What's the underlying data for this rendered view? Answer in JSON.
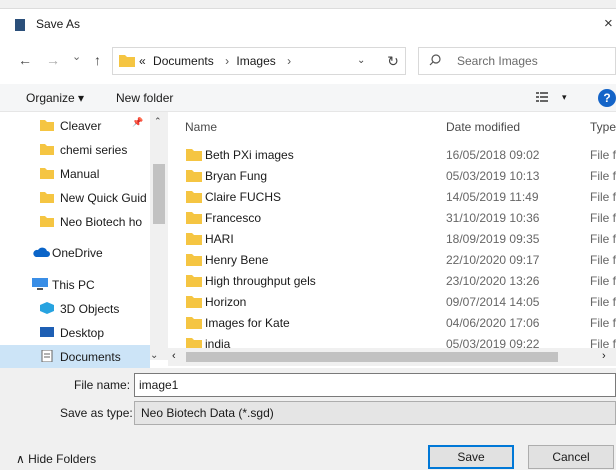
{
  "window": {
    "title": "Save As",
    "close_glyph": "×"
  },
  "nav_buttons": {
    "back": "←",
    "forward": "→",
    "recent": "⌄",
    "up": "↑"
  },
  "address": {
    "crumbs": [
      "«",
      "Documents",
      "›",
      "Images",
      "›"
    ],
    "dropdown": "⌄"
  },
  "refresh_glyph": "↻",
  "search": {
    "placeholder": "Search Images"
  },
  "toolbar": {
    "organize": "Organize ▾",
    "new_folder": "New folder",
    "view_dropdown": "▾",
    "help": "?"
  },
  "sidebar": {
    "items": [
      {
        "label": "Cleaver",
        "icon": "folder-icon"
      },
      {
        "label": "chemi series",
        "icon": "folder-icon"
      },
      {
        "label": "Manual",
        "icon": "folder-icon"
      },
      {
        "label": "New Quick Guid",
        "icon": "folder-icon"
      },
      {
        "label": "Neo Biotech ho",
        "icon": "folder-icon"
      },
      {
        "label": "OneDrive",
        "icon": "cloud-icon"
      },
      {
        "label": "This PC",
        "icon": "pc-icon"
      },
      {
        "label": "3D Objects",
        "icon": "cube-icon"
      },
      {
        "label": "Desktop",
        "icon": "desktop-icon"
      },
      {
        "label": "Documents",
        "icon": "documents-icon"
      }
    ],
    "pin_glyph": "📌"
  },
  "file_list": {
    "columns": {
      "name": "Name",
      "date": "Date modified",
      "type": "Type"
    },
    "rows": [
      {
        "name": "Beth PXi images",
        "date": "16/05/2018 09:02",
        "type": "File f"
      },
      {
        "name": "Bryan Fung",
        "date": "05/03/2019 10:13",
        "type": "File f"
      },
      {
        "name": "Claire FUCHS",
        "date": "14/05/2019 11:49",
        "type": "File f"
      },
      {
        "name": "Francesco",
        "date": "31/10/2019 10:36",
        "type": "File f"
      },
      {
        "name": "HARI",
        "date": "18/09/2019 09:35",
        "type": "File f"
      },
      {
        "name": "Henry Bene",
        "date": "22/10/2020 09:17",
        "type": "File f"
      },
      {
        "name": "High throughput gels",
        "date": "23/10/2020 13:26",
        "type": "File f"
      },
      {
        "name": "Horizon",
        "date": "09/07/2014 14:05",
        "type": "File f"
      },
      {
        "name": "Images for Kate",
        "date": "04/06/2020 17:06",
        "type": "File f"
      },
      {
        "name": "india",
        "date": "05/03/2019 09:22",
        "type": "File f"
      }
    ]
  },
  "scroll_glyphs": {
    "left": "‹",
    "right": "›",
    "up": "⌃",
    "down": "⌄"
  },
  "form": {
    "file_name_label": "File name:",
    "file_name_value": "image1",
    "save_type_label": "Save as type:",
    "save_type_value": "Neo Biotech Data (*.sgd)"
  },
  "footer": {
    "hide_folders": "∧ Hide Folders",
    "save": "Save",
    "cancel": "Cancel"
  },
  "colors": {
    "folder": "#f5c542",
    "accent": "#0078d7",
    "selection": "#cce4f7"
  }
}
